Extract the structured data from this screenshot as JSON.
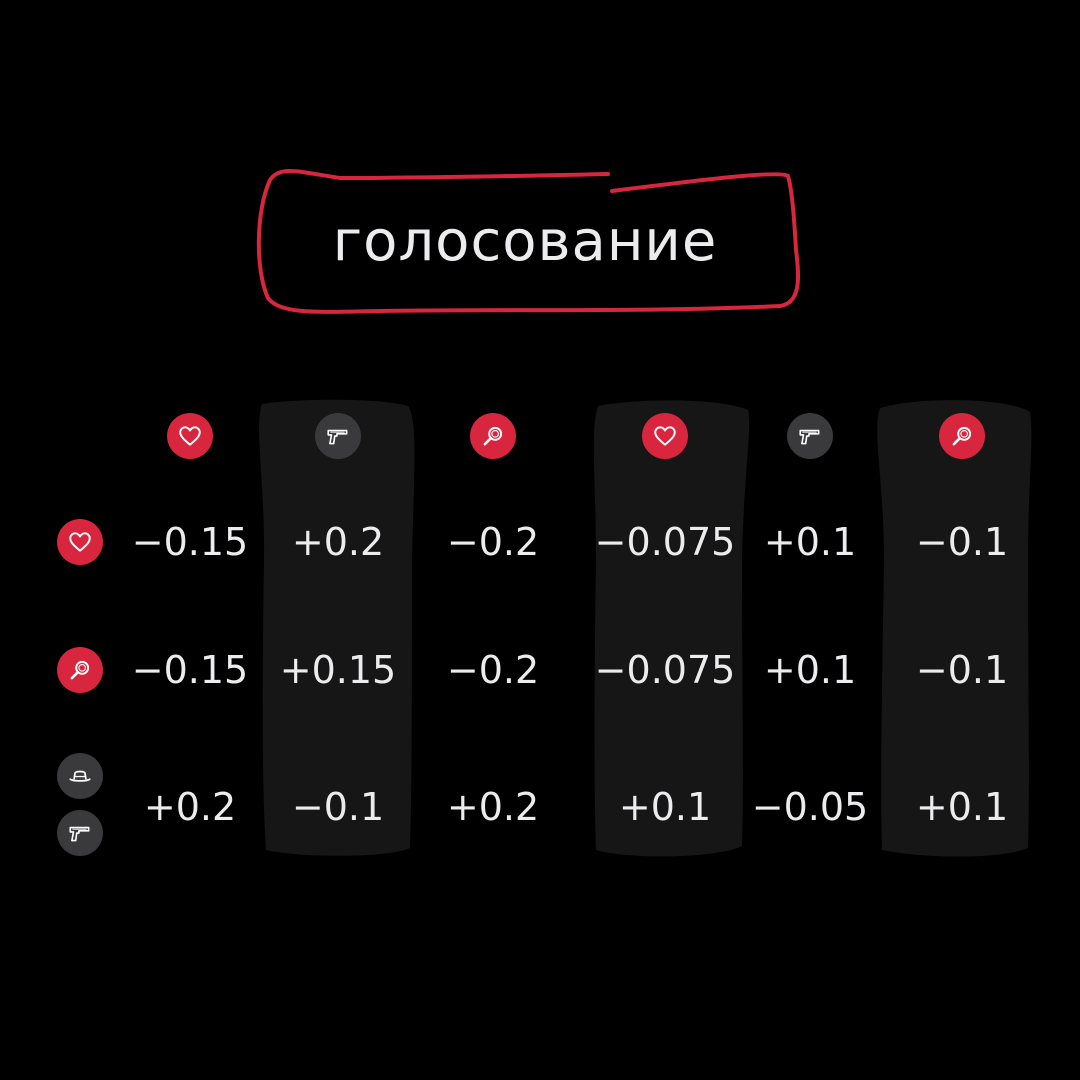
{
  "title": "голосование",
  "colors": {
    "background": "#000000",
    "accent_red": "#D7263D",
    "icon_gray": "#3A3A3C",
    "column_highlight": "#161616",
    "text": "#ECECEF"
  },
  "column_icons": [
    {
      "icon": "heart-icon",
      "style": "red"
    },
    {
      "icon": "gun-icon",
      "style": "gray"
    },
    {
      "icon": "magnifier-icon",
      "style": "red"
    },
    {
      "icon": "heart-icon",
      "style": "red"
    },
    {
      "icon": "gun-icon",
      "style": "gray"
    },
    {
      "icon": "magnifier-icon",
      "style": "red"
    }
  ],
  "rows": [
    {
      "icons": [
        "heart-icon"
      ],
      "values": [
        "−0.15",
        "+0.2",
        "−0.2",
        "−0.075",
        "+0.1",
        "−0.1"
      ]
    },
    {
      "icons": [
        "magnifier-icon"
      ],
      "values": [
        "−0.15",
        "+0.15",
        "−0.2",
        "−0.075",
        "+0.1",
        "−0.1"
      ]
    },
    {
      "icons": [
        "hat-icon",
        "gun-icon"
      ],
      "values": [
        "+0.2",
        "−0.1",
        "+0.2",
        "+0.1",
        "−0.05",
        "+0.1"
      ]
    }
  ]
}
